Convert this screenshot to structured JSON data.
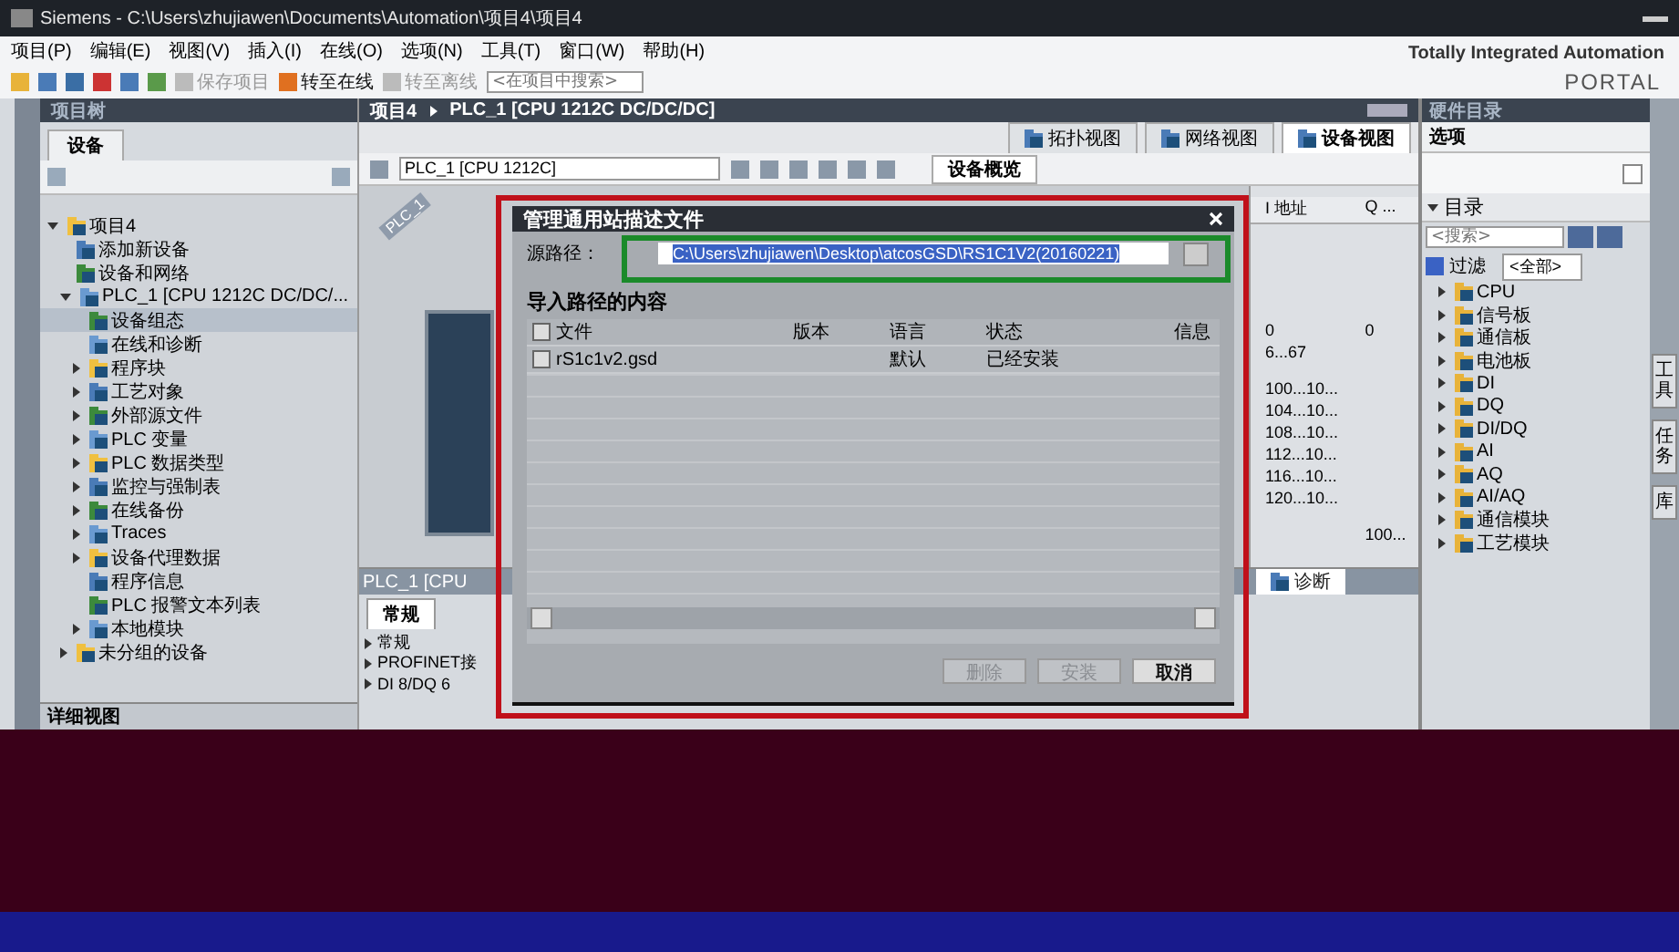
{
  "window": {
    "title": "Siemens  -  C:\\Users\\zhujiawen\\Documents\\Automation\\项目4\\项目4"
  },
  "menu": [
    "项目(P)",
    "编辑(E)",
    "视图(V)",
    "插入(I)",
    "在线(O)",
    "选项(N)",
    "工具(T)",
    "窗口(W)",
    "帮助(H)"
  ],
  "toolbar": {
    "buttons": [
      {
        "label": "保存项目",
        "disabled": true
      },
      {
        "label": "转至在线",
        "disabled": false
      },
      {
        "label": "转至离线",
        "disabled": true
      }
    ],
    "search": {
      "placeholder": "<在项目中搜索>"
    }
  },
  "branding": {
    "line1": "Totally Integrated Automation",
    "line2": "PORTAL"
  },
  "project_tree": {
    "title": "项目树",
    "tabs": [
      {
        "label": "设备",
        "selected": true
      }
    ],
    "items": [
      {
        "label": "项目4",
        "expanded": true,
        "selected": false,
        "children": [
          {
            "label": "添加新设备",
            "selected": false
          },
          {
            "label": "设备和网络",
            "selected": false
          },
          {
            "label": "PLC_1 [CPU 1212C DC/DC/...",
            "expanded": true,
            "selected": false,
            "children": [
              {
                "label": "设备组态",
                "selected": true
              },
              {
                "label": "在线和诊断",
                "selected": false
              },
              {
                "label": "程序块",
                "expanded": false,
                "selected": false
              },
              {
                "label": "工艺对象",
                "expanded": false,
                "selected": false
              },
              {
                "label": "外部源文件",
                "expanded": false,
                "selected": false
              },
              {
                "label": "PLC 变量",
                "expanded": false,
                "selected": false
              },
              {
                "label": "PLC 数据类型",
                "expanded": false,
                "selected": false
              },
              {
                "label": "监控与强制表",
                "expanded": false,
                "selected": false
              },
              {
                "label": "在线备份",
                "expanded": false,
                "selected": false
              },
              {
                "label": "Traces",
                "expanded": false,
                "selected": false
              },
              {
                "label": "设备代理数据",
                "expanded": false,
                "selected": false
              },
              {
                "label": "程序信息",
                "selected": false
              },
              {
                "label": "PLC 报警文本列表",
                "selected": false
              },
              {
                "label": "本地模块",
                "expanded": false,
                "selected": false
              }
            ]
          },
          {
            "label": "未分组的设备",
            "expanded": false,
            "selected": false
          }
        ]
      }
    ],
    "detail_view": {
      "title": "详细视图"
    }
  },
  "device_editor": {
    "breadcrumb": [
      "项目4",
      "PLC_1 [CPU 1212C DC/DC/DC]"
    ],
    "view_tabs": [
      {
        "label": "拓扑视图",
        "selected": false
      },
      {
        "label": "网络视图",
        "selected": false
      },
      {
        "label": "设备视图",
        "selected": true
      }
    ],
    "device_select": {
      "value": "PLC_1 [CPU 1212C]"
    },
    "overview_tab": {
      "label": "设备概览"
    },
    "device_tag": "PLC_1",
    "overview": {
      "columns": [
        "I 地址",
        "Q ..."
      ],
      "rows": [
        {
          "i": "0",
          "q": "0"
        },
        {
          "i": "6...67"
        },
        {
          "i": "100...10..."
        },
        {
          "i": "104...10..."
        },
        {
          "i": "108...10..."
        },
        {
          "i": "112...10..."
        },
        {
          "i": "116...10..."
        },
        {
          "i": "120...10..."
        },
        {
          "q": "100..."
        }
      ]
    },
    "inspector": {
      "title": "PLC_1 [CPU",
      "tabs": [
        {
          "label": "常规",
          "selected": true
        }
      ],
      "items": [
        "常规",
        "PROFINET接",
        "DI 8/DQ 6"
      ],
      "diagnostics_tab": "诊断"
    }
  },
  "dialog": {
    "title": "管理通用站描述文件",
    "source_path": {
      "label": "源路径：",
      "value": "C:\\Users\\zhujiawen\\Desktop\\atcosGSD\\RS1C1V2(20160221)"
    },
    "content_title": "导入路径的内容",
    "select_all": {
      "checked": false
    },
    "columns": [
      "文件",
      "版本",
      "语言",
      "状态",
      "信息"
    ],
    "rows": [
      {
        "checked": false,
        "file": "rS1c1v2.gsd",
        "language": "默认",
        "status": "已经安装"
      }
    ],
    "buttons": [
      {
        "label": "删除",
        "disabled": true
      },
      {
        "label": "安装",
        "disabled": true
      },
      {
        "label": "取消",
        "disabled": false
      }
    ]
  },
  "catalog": {
    "title": "硬件目录",
    "options_label": "选项",
    "section": {
      "label": "目录",
      "expanded": true
    },
    "search": {
      "placeholder": "<搜索>"
    },
    "filter": {
      "label": "过滤",
      "checked": true,
      "value": "<全部>"
    },
    "items": [
      {
        "label": "CPU",
        "expanded": false
      },
      {
        "label": "信号板",
        "expanded": false
      },
      {
        "label": "通信板",
        "expanded": false
      },
      {
        "label": "电池板",
        "expanded": false
      },
      {
        "label": "DI",
        "expanded": false
      },
      {
        "label": "DQ",
        "expanded": false
      },
      {
        "label": "DI/DQ",
        "expanded": false
      },
      {
        "label": "AI",
        "expanded": false
      },
      {
        "label": "AQ",
        "expanded": false
      },
      {
        "label": "AI/AQ",
        "expanded": false
      },
      {
        "label": "通信模块",
        "expanded": false
      },
      {
        "label": "工艺模块",
        "expanded": false
      }
    ]
  },
  "side_tabs": [
    {
      "label": "工具",
      "selected": false
    },
    {
      "label": "任务",
      "selected": false
    },
    {
      "label": "库",
      "selected": false
    }
  ]
}
